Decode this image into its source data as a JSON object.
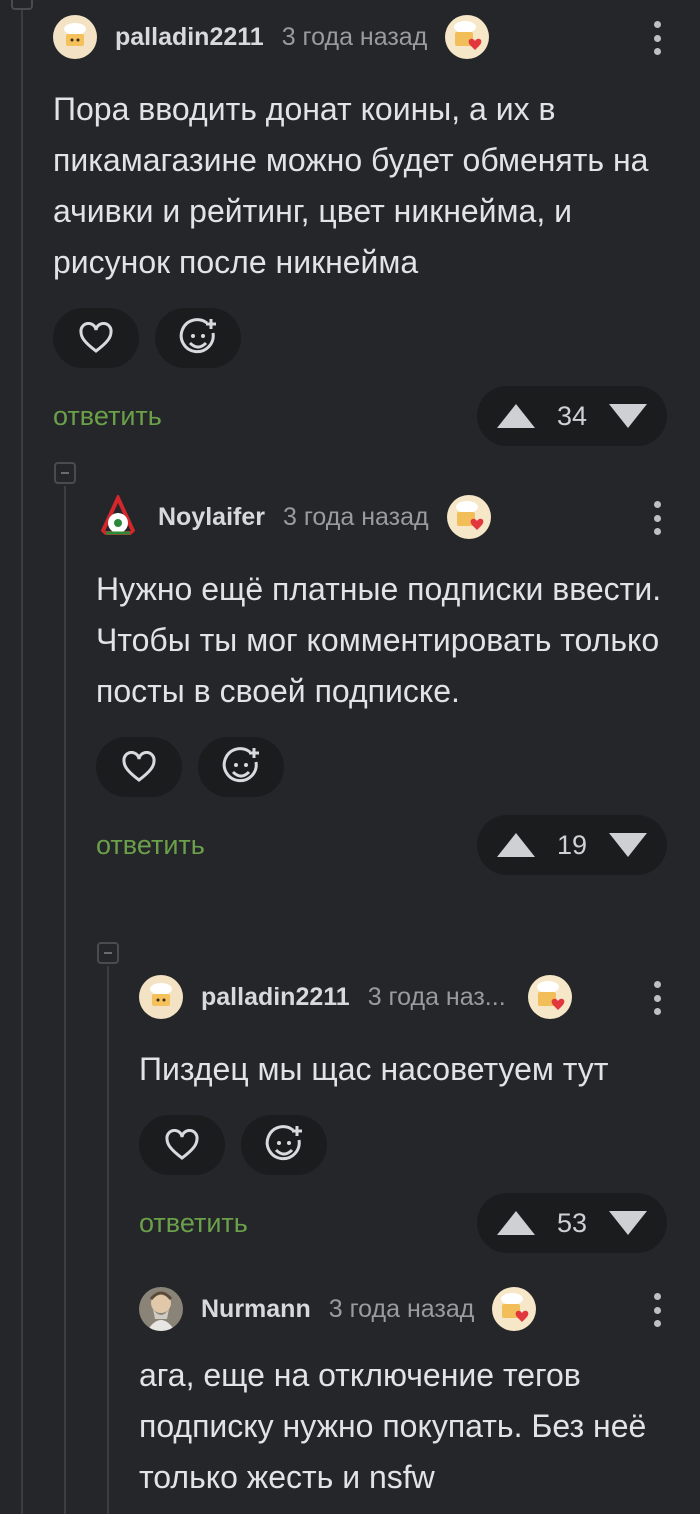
{
  "comments": [
    {
      "username": "palladin2211",
      "time": "3 года назад",
      "text": "Пора вводить донат коины, а их в пикамагазине можно будет обменять на ачивки и рейтинг, цвет никнейма, и рисунок после никнейма",
      "reply_label": "ответить",
      "score": "34"
    },
    {
      "username": "Noylaifer",
      "time": "3 года назад",
      "text": "Нужно ещё платные подписки ввести. Чтобы ты мог комментировать только посты в своей подписке.",
      "reply_label": "ответить",
      "score": "19"
    },
    {
      "username": "palladin2211",
      "time": "3 года наз...",
      "text": "Пиздец мы щас насоветуем тут",
      "reply_label": "ответить",
      "score": "53"
    },
    {
      "username": "Nurmann",
      "time": "3 года назад",
      "text": "ага, еще на отключение тегов подписку нужно покупать. Без неё только жесть и nsfw"
    }
  ],
  "colors": {
    "background": "#252629",
    "reply_link": "#6ba04a",
    "pill": "#1b1c1e"
  },
  "icons": [
    "heart-icon",
    "emoji-add-icon",
    "arrow-up-icon",
    "arrow-down-icon",
    "more-vertical-icon",
    "award-cake-icon"
  ]
}
